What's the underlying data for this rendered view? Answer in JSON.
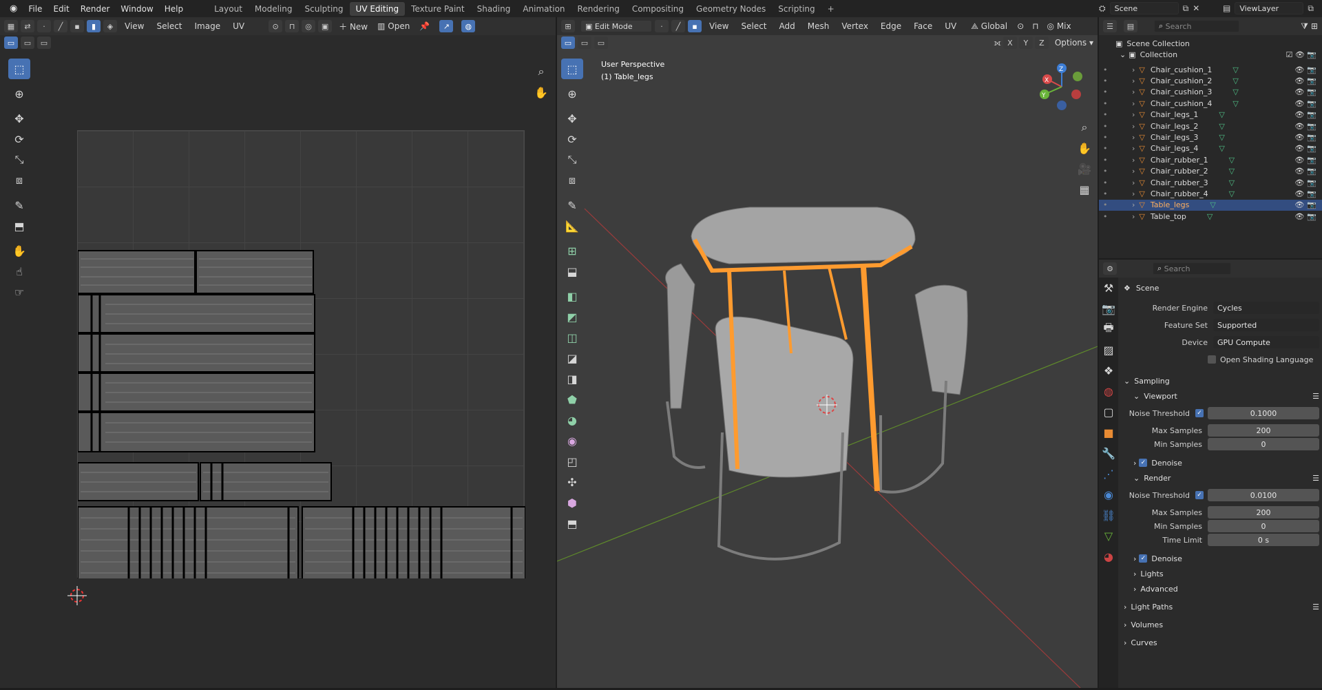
{
  "topbar": {
    "menus": [
      "File",
      "Edit",
      "Render",
      "Window",
      "Help"
    ],
    "workspaces": [
      "Layout",
      "Modeling",
      "Sculpting",
      "UV Editing",
      "Texture Paint",
      "Shading",
      "Animation",
      "Rendering",
      "Compositing",
      "Geometry Nodes",
      "Scripting"
    ],
    "active_workspace": "UV Editing",
    "add_tab": "+",
    "scene_label": "Scene",
    "viewlayer_label": "ViewLayer"
  },
  "uv_editor": {
    "menus": [
      "View",
      "Select",
      "Image",
      "UV"
    ],
    "new_label": "New",
    "open_label": "Open"
  },
  "viewport": {
    "mode": "Edit Mode",
    "menus": [
      "View",
      "Select",
      "Add",
      "Mesh",
      "Vertex",
      "Edge",
      "Face",
      "UV"
    ],
    "orientation": "Global",
    "mix_label": "Mix",
    "options_label": "Options",
    "axes_xyz": [
      "X",
      "Y",
      "Z"
    ],
    "overlay_line1": "User Perspective",
    "overlay_line2": "(1) Table_legs",
    "gizmo": {
      "x": "X",
      "y": "Y",
      "z": "Z"
    }
  },
  "outliner": {
    "search_placeholder": "Search",
    "scene_collection": "Scene Collection",
    "collection": "Collection",
    "items": [
      "Chair_cushion_1",
      "Chair_cushion_2",
      "Chair_cushion_3",
      "Chair_cushion_4",
      "Chair_legs_1",
      "Chair_legs_2",
      "Chair_legs_3",
      "Chair_legs_4",
      "Chair_rubber_1",
      "Chair_rubber_2",
      "Chair_rubber_3",
      "Chair_rubber_4",
      "Table_legs",
      "Table_top"
    ],
    "selected": "Table_legs"
  },
  "properties": {
    "search_placeholder": "Search",
    "scene_title": "Scene",
    "render_engine_label": "Render Engine",
    "render_engine": "Cycles",
    "feature_set_label": "Feature Set",
    "feature_set": "Supported",
    "device_label": "Device",
    "device": "GPU Compute",
    "osl_label": "Open Shading Language",
    "sampling": "Sampling",
    "viewport_section": "Viewport",
    "noise_threshold_label": "Noise Threshold",
    "viewport_noise": "0.1000",
    "max_samples_label": "Max Samples",
    "viewport_max": "200",
    "min_samples_label": "Min Samples",
    "viewport_min": "0",
    "denoise_label": "Denoise",
    "render_section": "Render",
    "render_noise": "0.0100",
    "render_max": "200",
    "render_min": "0",
    "time_limit_label": "Time Limit",
    "time_limit": "0 s",
    "lights": "Lights",
    "advanced": "Advanced",
    "light_paths": "Light Paths",
    "volumes": "Volumes",
    "curves": "Curves"
  },
  "colors": {
    "accent": "#4772b3",
    "selection": "#ff9b2f",
    "bg": "#1d1d1d"
  }
}
